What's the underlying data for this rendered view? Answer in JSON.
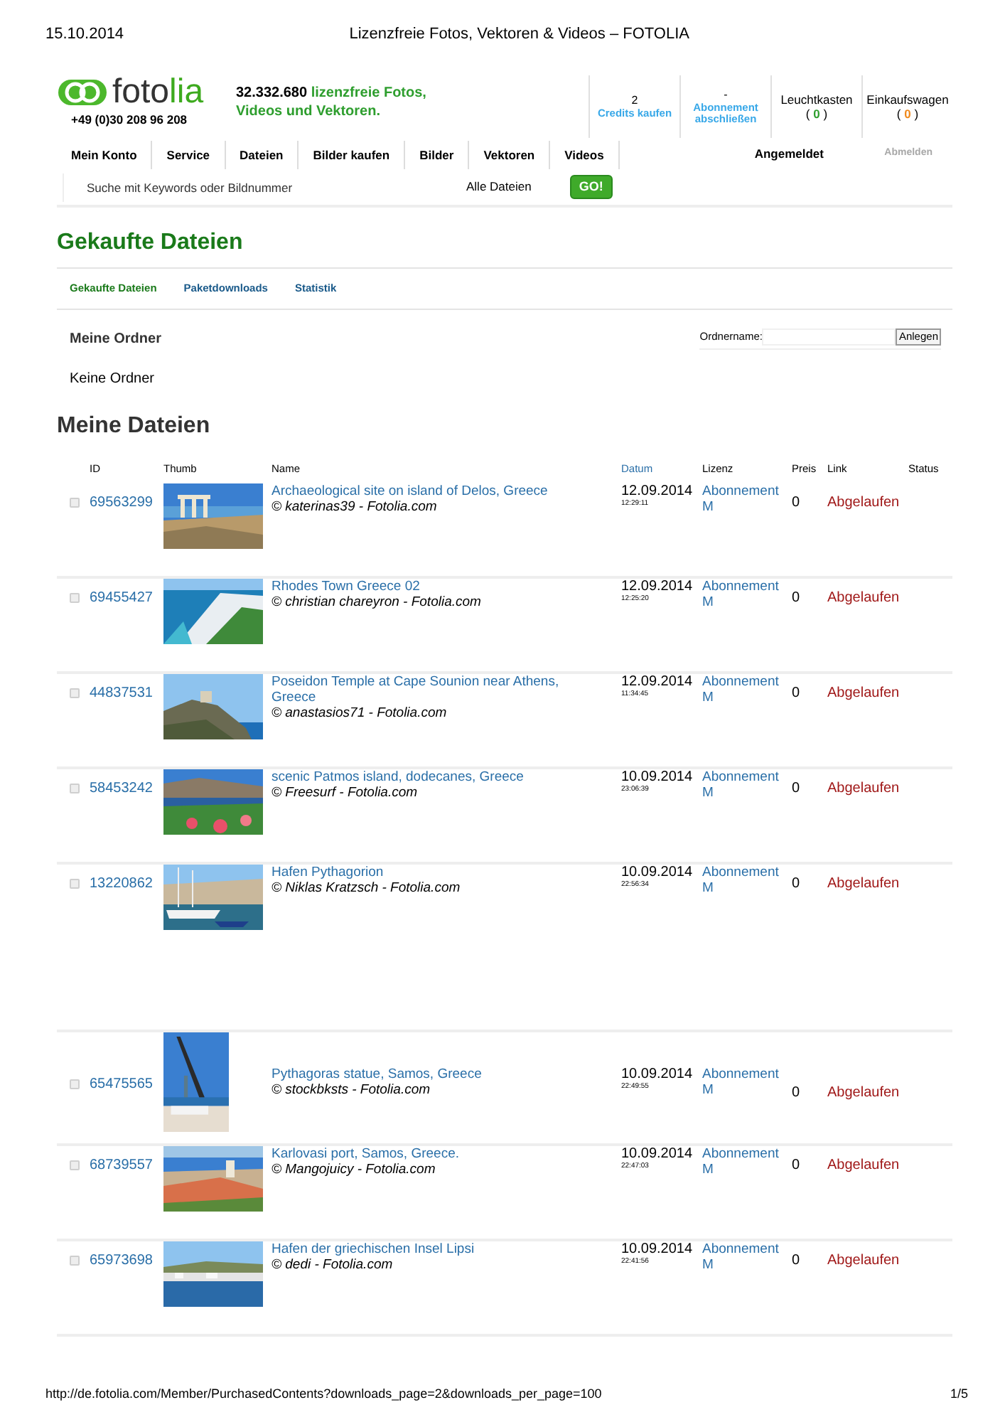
{
  "print_header": {
    "date": "15.10.2014",
    "title": "Lizenzfreie Fotos, Vektoren & Videos – FOTOLIA"
  },
  "logo": {
    "text_a": "foto",
    "text_b": "lia",
    "phone": "+49 (0)30 208 96 208"
  },
  "tagline": {
    "count": "32.332.680",
    "text": "lizenzfreie Fotos, Videos und Vektoren."
  },
  "header_stats": [
    {
      "kind": "link",
      "value": "2",
      "label": "Credits kaufen"
    },
    {
      "kind": "link",
      "value": "-",
      "label": "Abonnement abschließen"
    },
    {
      "kind": "counter",
      "label": "Leuchtkasten",
      "open": "(",
      "count": "0",
      "close": ")",
      "color": "#2e9e2e"
    },
    {
      "kind": "counter",
      "label": "Einkaufswagen",
      "open": "(",
      "count": "0",
      "close": ")",
      "color": "#f08a1c"
    }
  ],
  "menu": [
    "Mein Konto",
    "Service",
    "Dateien",
    "Bilder kaufen",
    "Bilder",
    "Vektoren",
    "Videos"
  ],
  "login_status": "Angemeldet",
  "logout": {
    "label": "Abmelden",
    "disabled": true
  },
  "search": {
    "placeholder": "Suche mit Keywords oder Bildnummer",
    "scope": "Alle Dateien",
    "button": "GO!"
  },
  "page_title": "Gekaufte Dateien",
  "tabs": [
    {
      "label": "Gekaufte Dateien",
      "selected": true
    },
    {
      "label": "Paketdownloads",
      "selected": false
    },
    {
      "label": "Statistik",
      "selected": false
    }
  ],
  "folders": {
    "title": "Meine Ordner",
    "field_label": "Ordnername:",
    "button": "Anlegen",
    "empty": "Keine Ordner"
  },
  "files_title": "Meine Dateien",
  "columns": [
    {
      "label": "ID",
      "link": false
    },
    {
      "label": "Thumb",
      "link": false
    },
    {
      "label": "Name",
      "link": false
    },
    {
      "label": "Datum",
      "link": true
    },
    {
      "label": "Lizenz",
      "link": false
    },
    {
      "label": "Preis",
      "link": false
    },
    {
      "label": "Link",
      "link": false
    },
    {
      "label": "Status",
      "link": false
    }
  ],
  "rows": [
    {
      "checked": false,
      "id": "69563299",
      "title": "Archaeological site on island of Delos, Greece",
      "credit": "© katerinas39 - Fotolia.com",
      "date": "12.09.2014",
      "time": "12:29:11",
      "license": "Abonnement M",
      "price": "0",
      "link": "Abgelaufen"
    },
    {
      "checked": false,
      "id": "69455427",
      "title": "Rhodes Town Greece 02",
      "credit": "© christian chareyron - Fotolia.com",
      "date": "12.09.2014",
      "time": "12:25:20",
      "license": "Abonnement M",
      "price": "0",
      "link": "Abgelaufen"
    },
    {
      "checked": false,
      "id": "44837531",
      "title": "Poseidon Temple at Cape Sounion near Athens, Greece",
      "credit": "© anastasios71 - Fotolia.com",
      "date": "12.09.2014",
      "time": "11:34:45",
      "license": "Abonnement M",
      "price": "0",
      "link": "Abgelaufen"
    },
    {
      "checked": false,
      "id": "58453242",
      "title": "scenic Patmos island, dodecanes, Greece",
      "credit": "© Freesurf - Fotolia.com",
      "date": "10.09.2014",
      "time": "23:06:39",
      "license": "Abonnement M",
      "price": "0",
      "link": "Abgelaufen"
    },
    {
      "checked": false,
      "id": "13220862",
      "title": "Hafen Pythagorion",
      "credit": "© Niklas Kratzsch - Fotolia.com",
      "date": "10.09.2014",
      "time": "22:56:34",
      "license": "Abonnement M",
      "price": "0",
      "link": "Abgelaufen"
    },
    {
      "checked": false,
      "id": "65475565",
      "title": "Pythagoras statue, Samos, Greece",
      "credit": "© stockbksts - Fotolia.com",
      "date": "10.09.2014",
      "time": "22:49:55",
      "license": "Abonnement M",
      "price": "0",
      "link": "Abgelaufen"
    },
    {
      "checked": false,
      "id": "68739557",
      "title": "Karlovasi port, Samos, Greece.",
      "credit": "© Mangojuicy - Fotolia.com",
      "date": "10.09.2014",
      "time": "22:47:03",
      "license": "Abonnement M",
      "price": "0",
      "link": "Abgelaufen"
    },
    {
      "checked": false,
      "id": "65973698",
      "title": "Hafen der griechischen Insel Lipsi",
      "credit": "© dedi - Fotolia.com",
      "date": "10.09.2014",
      "time": "22:41:56",
      "license": "Abonnement M",
      "price": "0",
      "link": "Abgelaufen"
    }
  ],
  "print_footer": {
    "url": "http://de.fotolia.com/Member/PurchasedContents?downloads_page=2&downloads_per_page=100",
    "page": "1/5"
  }
}
